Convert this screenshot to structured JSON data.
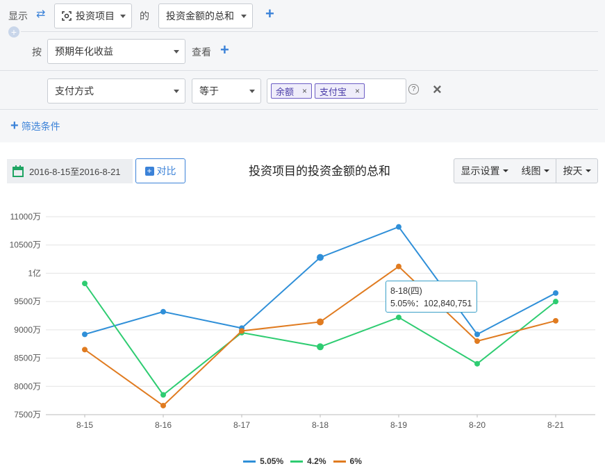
{
  "filters": {
    "show_label": "显示",
    "dimension_select": "投资项目",
    "of_label": "的",
    "metric_select": "投资金额的总和",
    "by_label": "按",
    "group_select": "预期年化收益",
    "view_label": "查看",
    "condition_field": "支付方式",
    "condition_op": "等于",
    "condition_values": [
      "余额",
      "支付宝"
    ],
    "add_filter_label": "筛选条件"
  },
  "toolbar": {
    "date_range": "2016-8-15至2016-8-21",
    "compare_label": "对比",
    "display_settings": "显示设置",
    "chart_type": "线图",
    "granularity": "按天"
  },
  "tooltip": {
    "title": "8-18(四)",
    "line": "5.05%：102,840,751"
  },
  "colors": {
    "accent": "#3b82d8",
    "series_505": "#2f8fd8",
    "series_42": "#2ecc71",
    "series_6": "#e07b20"
  },
  "chart_data": {
    "type": "line",
    "title": "投资项目的投资金额的总和",
    "categories": [
      "8-15",
      "8-16",
      "8-17",
      "8-18",
      "8-19",
      "8-20",
      "8-21"
    ],
    "y_unit": "万",
    "ylim": [
      7500,
      11000
    ],
    "y_ticks": [
      7500,
      8000,
      8500,
      9000,
      9500,
      10000,
      10500,
      11000
    ],
    "y_tick_labels": [
      "7500万",
      "8000万",
      "8500万",
      "9000万",
      "9500万",
      "1亿",
      "10500万",
      "11000万"
    ],
    "grid": true,
    "legend_position": "bottom-center",
    "series": [
      {
        "name": "5.05%",
        "color": "#2f8fd8",
        "values": [
          8920,
          9320,
          9030,
          10280,
          10820,
          8920,
          9650
        ]
      },
      {
        "name": "4.2%",
        "color": "#2ecc71",
        "values": [
          9820,
          7850,
          8950,
          8700,
          9220,
          8400,
          9500
        ]
      },
      {
        "name": "6%",
        "color": "#e07b20",
        "values": [
          8650,
          7660,
          8980,
          9140,
          10120,
          8800,
          9160
        ]
      }
    ]
  }
}
